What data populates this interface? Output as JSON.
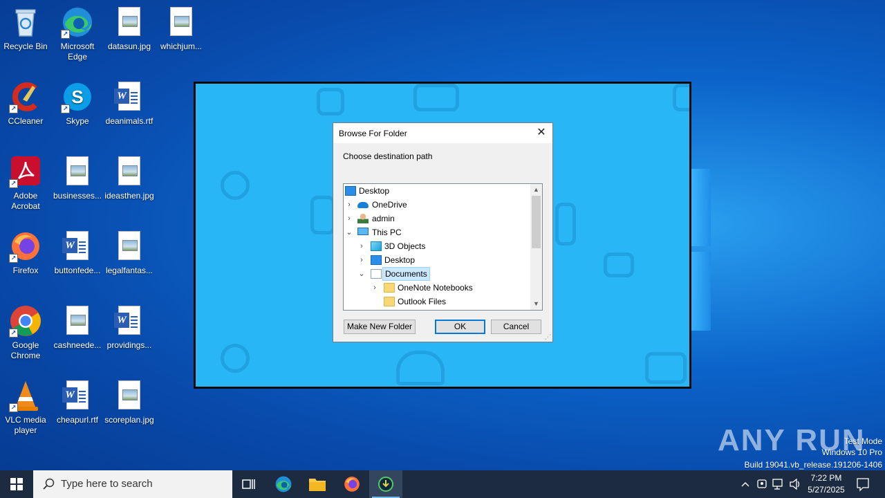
{
  "desktop": {
    "icons": [
      {
        "label": "Recycle Bin"
      },
      {
        "label": "Microsoft Edge"
      },
      {
        "label": "datasun.jpg"
      },
      {
        "label": "whichjum..."
      },
      {
        "label": "CCleaner"
      },
      {
        "label": "Skype"
      },
      {
        "label": "deanimals.rtf"
      },
      {
        "label": "Adobe Acrobat"
      },
      {
        "label": "businesses..."
      },
      {
        "label": "ideasthen.jpg"
      },
      {
        "label": "Firefox"
      },
      {
        "label": "buttonfede..."
      },
      {
        "label": "legalfantas..."
      },
      {
        "label": "Google Chrome"
      },
      {
        "label": "cashneede..."
      },
      {
        "label": "providings..."
      },
      {
        "label": "VLC media player"
      },
      {
        "label": "cheapurl.rtf"
      },
      {
        "label": "scoreplan.jpg"
      }
    ]
  },
  "dialog": {
    "title": "Browse For Folder",
    "close_glyph": "✕",
    "prompt": "Choose destination path",
    "tree": [
      {
        "label": "Desktop",
        "icon": "desktop-icon",
        "expander": ""
      },
      {
        "label": "OneDrive",
        "icon": "onedrive-icon",
        "expander": "›"
      },
      {
        "label": "admin",
        "icon": "user-icon",
        "expander": "›"
      },
      {
        "label": "This PC",
        "icon": "pc-icon",
        "expander": "⌄"
      },
      {
        "label": "3D Objects",
        "icon": "cube-icon",
        "expander": "›"
      },
      {
        "label": "Desktop",
        "icon": "desktop-icon",
        "expander": "›"
      },
      {
        "label": "Documents",
        "icon": "documents-icon",
        "expander": "⌄",
        "selected": true
      },
      {
        "label": "OneNote Notebooks",
        "icon": "folder-icon",
        "expander": "›"
      },
      {
        "label": "Outlook Files",
        "icon": "folder-icon",
        "expander": ""
      }
    ],
    "buttons": {
      "new_folder": "Make New Folder",
      "ok": "OK",
      "cancel": "Cancel"
    }
  },
  "watermark": {
    "brand": "ANY RUN",
    "line1": "Test Mode",
    "line2": "Windows 10 Pro",
    "line3": "Build 19041.vb_release.191206-1406"
  },
  "taskbar": {
    "search_placeholder": "Type here to search",
    "time": "7:22 PM",
    "date": "5/27/2025"
  },
  "colors": {
    "desktop_blue": "#0b63c9",
    "app_bg": "#29b6f6",
    "taskbar": "#1c2b3f",
    "selection": "#cce8ff",
    "accent": "#0078d7"
  }
}
